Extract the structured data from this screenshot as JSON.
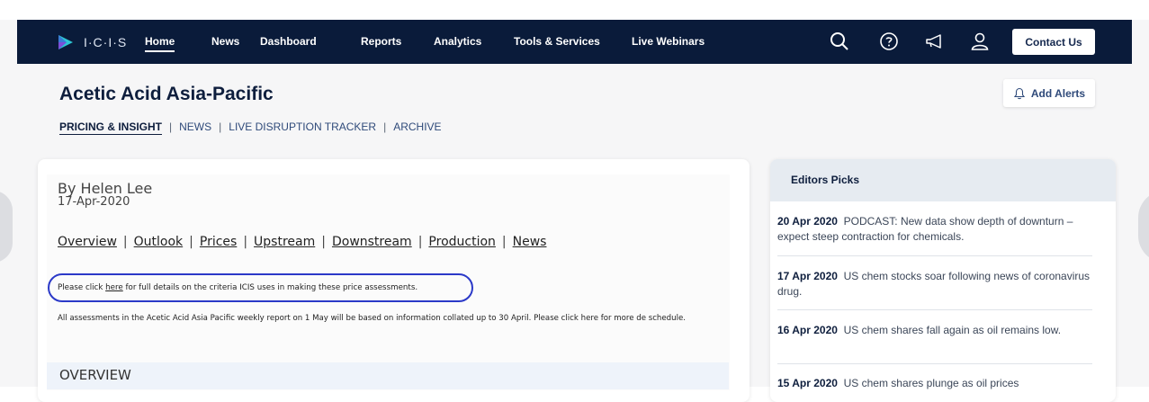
{
  "nav": {
    "logo_text": "I·C·I·S",
    "items": [
      "Home",
      "News",
      "Dashboard",
      "Reports",
      "Analytics",
      "Tools & Services",
      "Live Webinars"
    ],
    "contact_label": "Contact Us",
    "icons": [
      "search-icon",
      "help-icon",
      "announcement-icon",
      "user-icon"
    ]
  },
  "page": {
    "title": "Acetic Acid Asia-Pacific",
    "add_alerts_label": "Add Alerts",
    "tabs": [
      "PRICING & INSIGHT",
      "NEWS",
      "LIVE DISRUPTION TRACKER",
      "ARCHIVE"
    ],
    "tab_separator": "|"
  },
  "article": {
    "author": "By Helen Lee",
    "date": "17-Apr-2020",
    "links": [
      "Overview",
      "Outlook",
      "Prices",
      "Upstream",
      "Downstream",
      "Production",
      "News"
    ],
    "link_separator": "|",
    "note_prefix": "Please click ",
    "note_link": "here",
    "note_suffix": " for full details on the criteria ICIS uses in making these price assessments.",
    "assessment_text": "All assessments in the Acetic Acid Asia Pacific weekly report on 1 May will be based on information collated up to 30 April. Please click here for more de schedule.",
    "section_title": "OVERVIEW"
  },
  "editors_picks": {
    "title": "Editors Picks",
    "items": [
      {
        "date": "20 Apr 2020",
        "text": "PODCAST: New data show depth of downturn – expect steep contraction for chemicals."
      },
      {
        "date": "17 Apr 2020",
        "text": "US chem stocks soar following news of coronavirus drug."
      },
      {
        "date": "16 Apr 2020",
        "text": "US chem shares fall again as oil remains low."
      },
      {
        "date": "15 Apr 2020",
        "text": "US chem shares plunge as oil prices"
      }
    ]
  },
  "colors": {
    "nav_background": "#0a1b3a",
    "highlight_outline": "#2b39c8",
    "picks_header": "#e6ebf1"
  }
}
